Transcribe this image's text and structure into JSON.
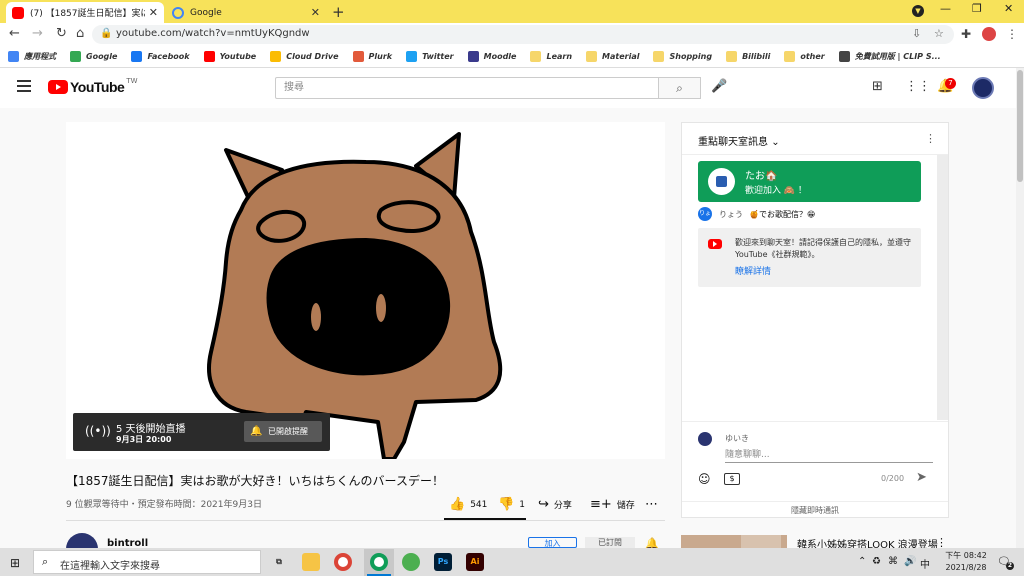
{
  "browser": {
    "tabs": [
      {
        "title": "(7) 【1857誕生日配信】実はお",
        "active": true
      },
      {
        "title": "Google",
        "active": false
      }
    ],
    "new_tab": "+",
    "url": "youtube.com/watch?v=nmtUyKQgndw",
    "bookmarks": [
      {
        "label": "應用程式",
        "icon": "apps-grid-icon",
        "color": "#4285f4"
      },
      {
        "label": "Google",
        "icon": "google-icon",
        "color": "#34a853"
      },
      {
        "label": "Facebook",
        "icon": "facebook-icon",
        "color": "#1877f2"
      },
      {
        "label": "Youtube",
        "icon": "youtube-icon",
        "color": "#ff0000"
      },
      {
        "label": "Cloud Drive",
        "icon": "drive-icon",
        "color": "#fbbc04"
      },
      {
        "label": "Plurk",
        "icon": "plurk-icon",
        "color": "#e25a3b"
      },
      {
        "label": "Twitter",
        "icon": "twitter-icon",
        "color": "#1da1f2"
      },
      {
        "label": "Moodle",
        "icon": "moodle-icon",
        "color": "#3a3a8c"
      },
      {
        "label": "Learn",
        "icon": "folder-icon",
        "color": "#f6d66a"
      },
      {
        "label": "Material",
        "icon": "folder-icon",
        "color": "#f6d66a"
      },
      {
        "label": "Shopping",
        "icon": "folder-icon",
        "color": "#f6d66a"
      },
      {
        "label": "Bilibili",
        "icon": "folder-icon",
        "color": "#f6d66a"
      },
      {
        "label": "other",
        "icon": "folder-icon",
        "color": "#f6d66a"
      },
      {
        "label": "免費試用版 | CLIP S...",
        "icon": "clip-studio-icon",
        "color": "#444"
      }
    ]
  },
  "youtube": {
    "logo_text": "YouTube",
    "country": "TW",
    "search_placeholder": "搜尋",
    "notification_count": "7"
  },
  "video": {
    "premiere_line1": "5 天後開始直播",
    "premiere_line2": "9月3日 20:00",
    "reminder_button": "已開啟提醒",
    "title": "【1857誕生日配信】実はお歌が大好き！いちはちくんのバースデー！",
    "meta": "9 位觀眾等待中・預定發布時間：2021年9月3日",
    "likes": "541",
    "dislikes": "1",
    "share": "分享",
    "save": "儲存",
    "channel": "bintroll",
    "join": "加入",
    "subscribed": "已訂閱"
  },
  "chat": {
    "header": "重點聊天室訊息",
    "greeting_name": "たお🏠",
    "greeting_msg": "歡迎加入 🙈 ！",
    "msg_avatar": "りょ",
    "msg_author": "りょう",
    "msg_text": "🍯でお歌配信？😁",
    "notice": "歡迎來到聊天室！請記得保護自己的隱私，並遵守 YouTube《社群規範》。",
    "notice_link": "瞭解詳情",
    "input_user": "ゆいき",
    "input_placeholder": "隨意聊聊...",
    "char_count": "0/200",
    "hide": "隱藏即時通訊"
  },
  "recommendation": {
    "title": "韓系小姊姊穿搭LOOK 浪漫登場"
  },
  "taskbar": {
    "search": "在這裡輸入文字來搜尋",
    "time": "下午 08:42",
    "date": "2021/8/28",
    "notif": "2"
  },
  "colors": {
    "tab_bar": "#f7e25a",
    "youtube_red": "#ff0000",
    "greet_green": "#0f9d58",
    "link_blue": "#1a73e8"
  }
}
